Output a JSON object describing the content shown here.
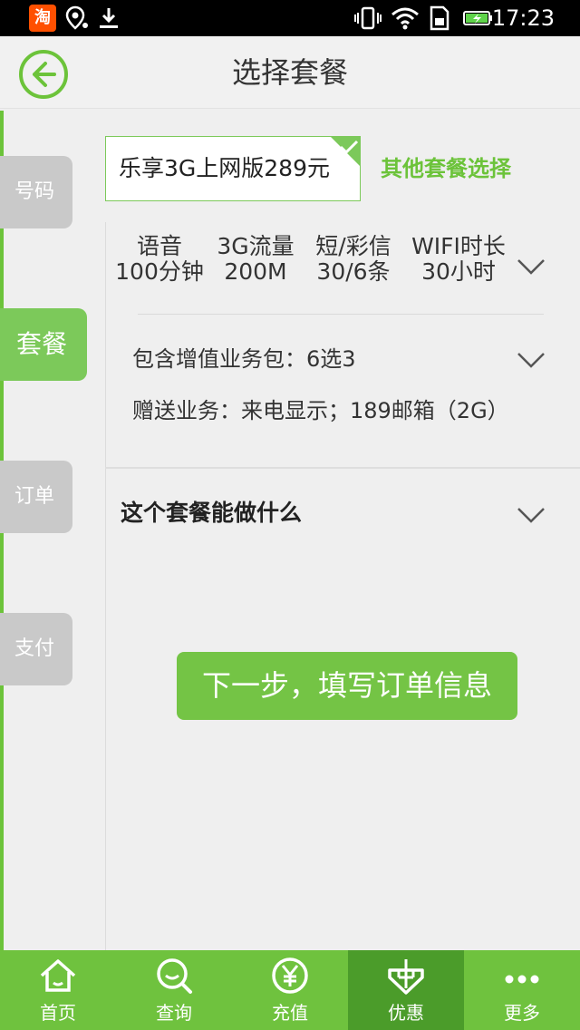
{
  "status_bar": {
    "app_badge": "淘",
    "time": "17:23"
  },
  "header": {
    "title": "选择套餐"
  },
  "side_tabs": [
    {
      "label": "号码",
      "active": false
    },
    {
      "label": "套餐",
      "active": true
    },
    {
      "label": "订单",
      "active": false
    },
    {
      "label": "支付",
      "active": false
    }
  ],
  "plan": {
    "selected_name": "乐享3G上网版289元",
    "other_link": "其他套餐选择"
  },
  "features": [
    {
      "name": "语音",
      "value": "100分钟"
    },
    {
      "name": "3G流量",
      "value": "200M"
    },
    {
      "name": "短/彩信",
      "value": "30/6条"
    },
    {
      "name": "WIFI时长",
      "value": "30小时"
    }
  ],
  "details": {
    "value_added": "包含增值业务包：6选3",
    "gift": "赠送业务：来电显示；189邮箱（2G）",
    "what_can": "这个套餐能做什么"
  },
  "next_button": "下一步，填写订单信息",
  "bottom_nav": [
    {
      "label": "首页",
      "icon": "home-icon",
      "active": false
    },
    {
      "label": "查询",
      "icon": "search-icon",
      "active": false
    },
    {
      "label": "充值",
      "icon": "yuan-icon",
      "active": false
    },
    {
      "label": "优惠",
      "icon": "discount-icon",
      "active": true
    },
    {
      "label": "更多",
      "icon": "more-icon",
      "active": false
    }
  ],
  "colors": {
    "accent": "#6fc23e",
    "accent_dark": "#4b9c2a",
    "tab_inactive": "#c9c9c9"
  }
}
